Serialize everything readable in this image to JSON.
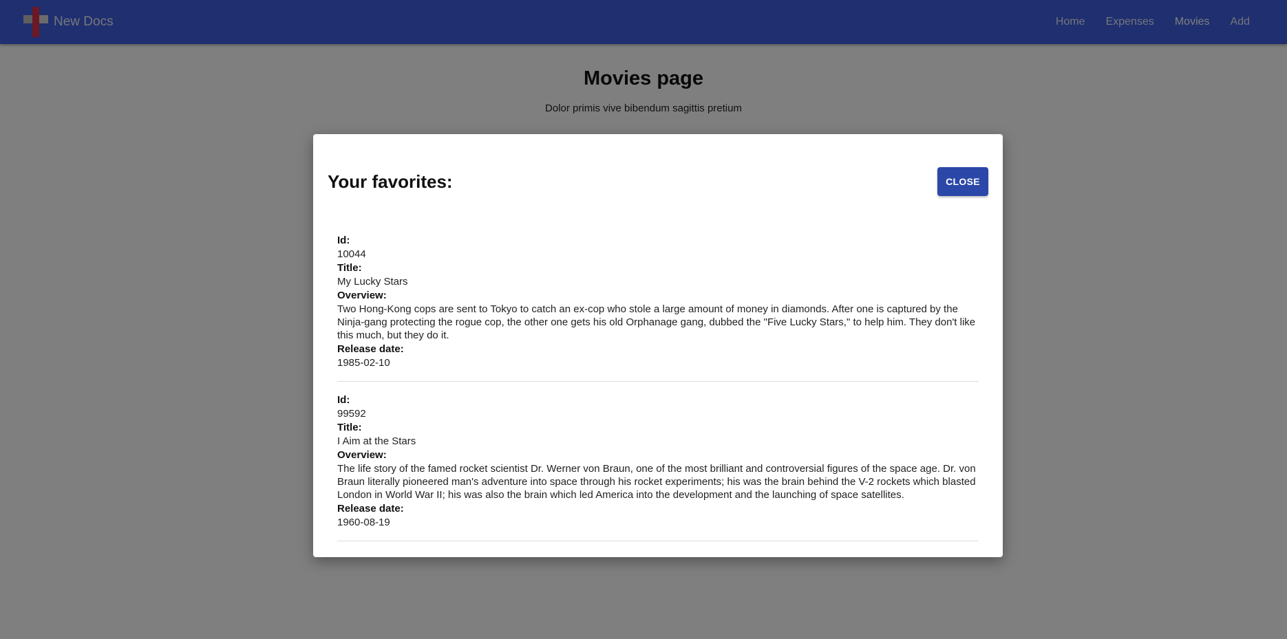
{
  "brand": {
    "name": "New Docs"
  },
  "nav": {
    "items": [
      {
        "label": "Home",
        "active": false
      },
      {
        "label": "Expenses",
        "active": false
      },
      {
        "label": "Movies",
        "active": true
      },
      {
        "label": "Add",
        "active": false
      }
    ]
  },
  "page": {
    "title": "Movies page",
    "subtitle": "Dolor primis vive bibendum sagittis pretium"
  },
  "modal": {
    "title": "Your favorites:",
    "close_label": "CLOSE",
    "labels": {
      "id": "Id:",
      "title": "Title:",
      "overview": "Overview:",
      "release_date": "Release date:"
    },
    "movies": [
      {
        "id": "10044",
        "title": "My Lucky Stars",
        "overview": "Two Hong-Kong cops are sent to Tokyo to catch an ex-cop who stole a large amount of money in diamonds. After one is captured by the Ninja-gang protecting the rogue cop, the other one gets his old Orphanage gang, dubbed the \"Five Lucky Stars,\" to help him. They don't like this much, but they do it.",
        "release_date": "1985-02-10"
      },
      {
        "id": "99592",
        "title": "I Aim at the Stars",
        "overview": "The life story of the famed rocket scientist Dr. Werner von Braun, one of the most brilliant and controversial figures of the space age. Dr. von Braun literally pioneered man's adventure into space through his rocket experiments; his was the brain behind the V-2 rockets which blasted London in World War II; his was also the brain which led America into the development and the launching of space satellites.",
        "release_date": "1960-08-19"
      }
    ]
  },
  "colors": {
    "header_bg": "#3f5fde",
    "button_bg": "#2b47a8",
    "logo_red": "#d8314a",
    "overlay": "rgba(0,0,0,0.5)"
  }
}
